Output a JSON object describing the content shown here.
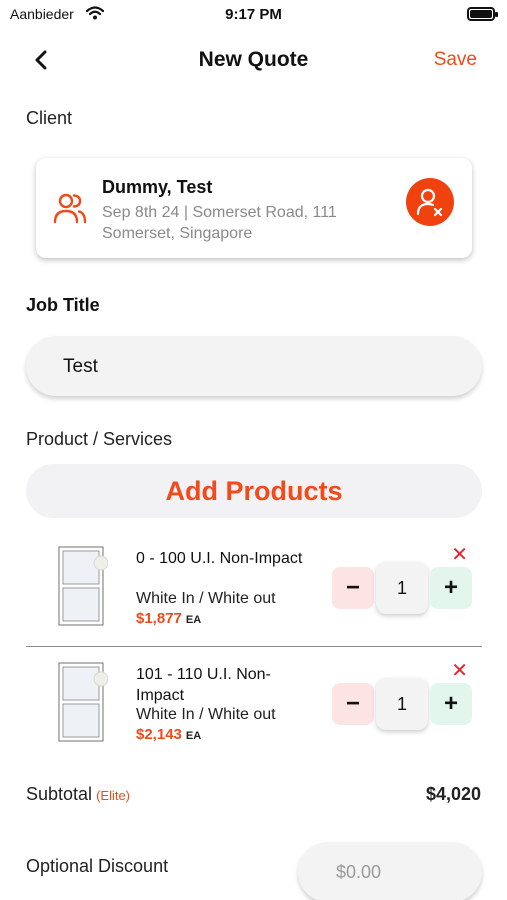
{
  "status": {
    "carrier": "Aanbieder",
    "time": "9:17 PM"
  },
  "nav": {
    "title": "New Quote",
    "save_label": "Save"
  },
  "client": {
    "label": "Client",
    "name": "Dummy, Test",
    "details": "Sep 8th 24 | Somerset Road, 111 Somerset, Singapore"
  },
  "job": {
    "label": "Job Title",
    "value": "Test"
  },
  "products": {
    "label": "Product / Services",
    "add_label": "Add Products",
    "items": [
      {
        "name": "0 - 100 U.I. Non-Impact",
        "finish": "White In / White out",
        "price": "$1,877",
        "unit": "EA",
        "qty": "1",
        "remove": "✕"
      },
      {
        "name": "101 - 110 U.I. Non-Impact",
        "finish": "White In / White out",
        "price": "$2,143",
        "unit": "EA",
        "qty": "1",
        "remove": "✕"
      }
    ]
  },
  "stepper": {
    "minus": "−",
    "plus": "+"
  },
  "summary": {
    "subtotal_label": "Subtotal",
    "tier": "(Elite)",
    "subtotal_value": "$4,020",
    "discount_label": "Optional Discount",
    "discount_placeholder": "$0.00"
  },
  "colors": {
    "accent": "#f04a1a",
    "remove": "#e8252a",
    "minus_bg": "#fde4e4",
    "plus_bg": "#e3f6ee"
  }
}
